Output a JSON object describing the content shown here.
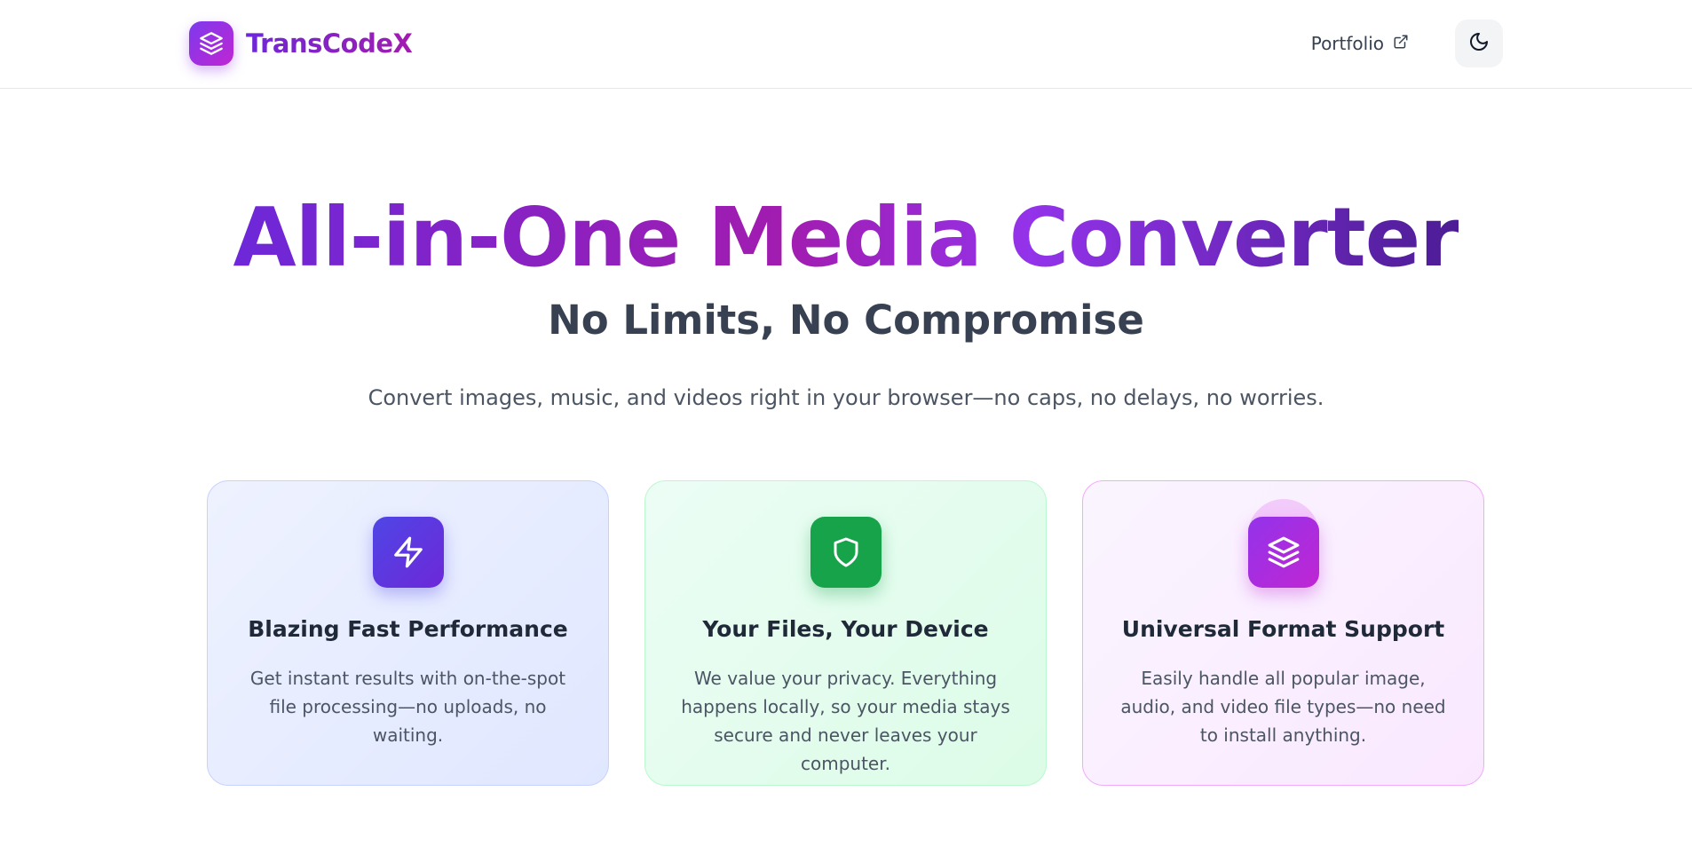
{
  "nav": {
    "brand_name": "TransCodeX",
    "brand_icon": "layers-icon",
    "portfolio_label": "Portfolio",
    "portfolio_icon": "external-link-icon",
    "theme_icon": "moon-icon"
  },
  "hero": {
    "title": "All-in-One Media Converter",
    "subtitle": "No Limits, No Compromise",
    "description": "Convert images, music, and videos right in your browser—no caps, no delays, no worries."
  },
  "features": [
    {
      "icon": "lightning-icon",
      "title": "Blazing Fast Performance",
      "text": "Get instant results with on-the-spot file processing—no uploads, no waiting.",
      "accent": "#4f46e5"
    },
    {
      "icon": "shield-icon",
      "title": "Your Files, Your Device",
      "text": "We value your privacy. Everything happens locally, so your media stays secure and never leaves your computer.",
      "accent": "#16a34a"
    },
    {
      "icon": "layers-icon",
      "title": "Universal Format Support",
      "text": "Easily handle all popular image, audio, and video file types—no need to install anything.",
      "accent": "#c026d3"
    }
  ],
  "colors": {
    "brand_start": "#7c3aed",
    "brand_end": "#c026d3"
  }
}
